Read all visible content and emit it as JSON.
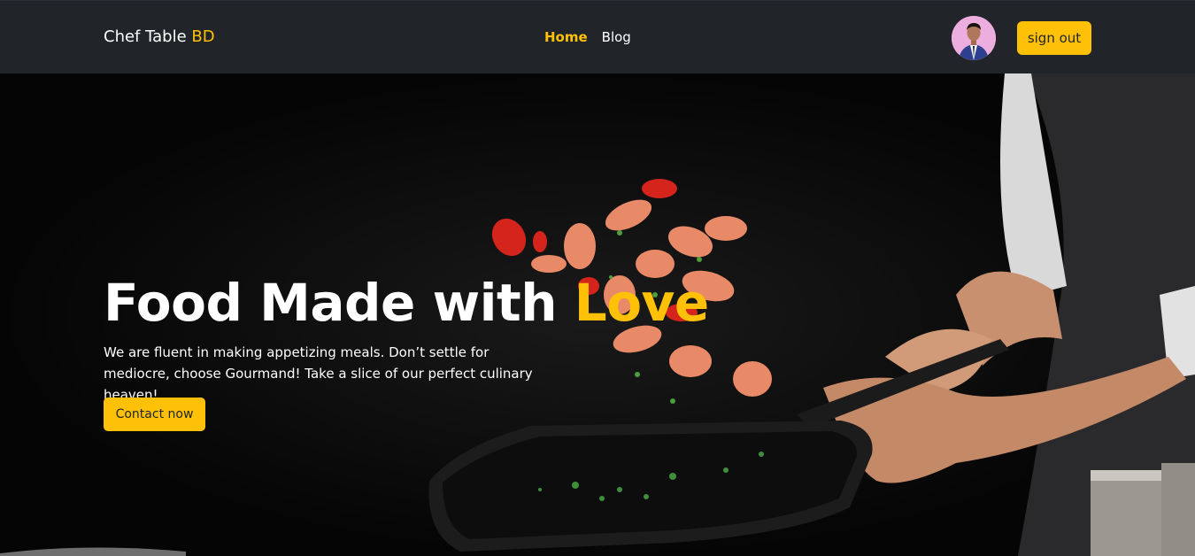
{
  "navbar": {
    "brand_text": "Chef Table ",
    "brand_accent": "BD",
    "links": [
      {
        "label": "Home",
        "active": true
      },
      {
        "label": "Blog",
        "active": false
      }
    ],
    "signout_label": "sign out"
  },
  "hero": {
    "title_text": "Food Made with ",
    "title_accent": "Love",
    "description": "We are fluent in making appetizing meals. Don’t settle for mediocre, choose Gourmand! Take a slice of our perfect culinary heaven!",
    "cta_label": "Contact now"
  },
  "colors": {
    "accent": "#ffc107",
    "navbar_bg": "#212529",
    "hero_bg": "#050505"
  }
}
